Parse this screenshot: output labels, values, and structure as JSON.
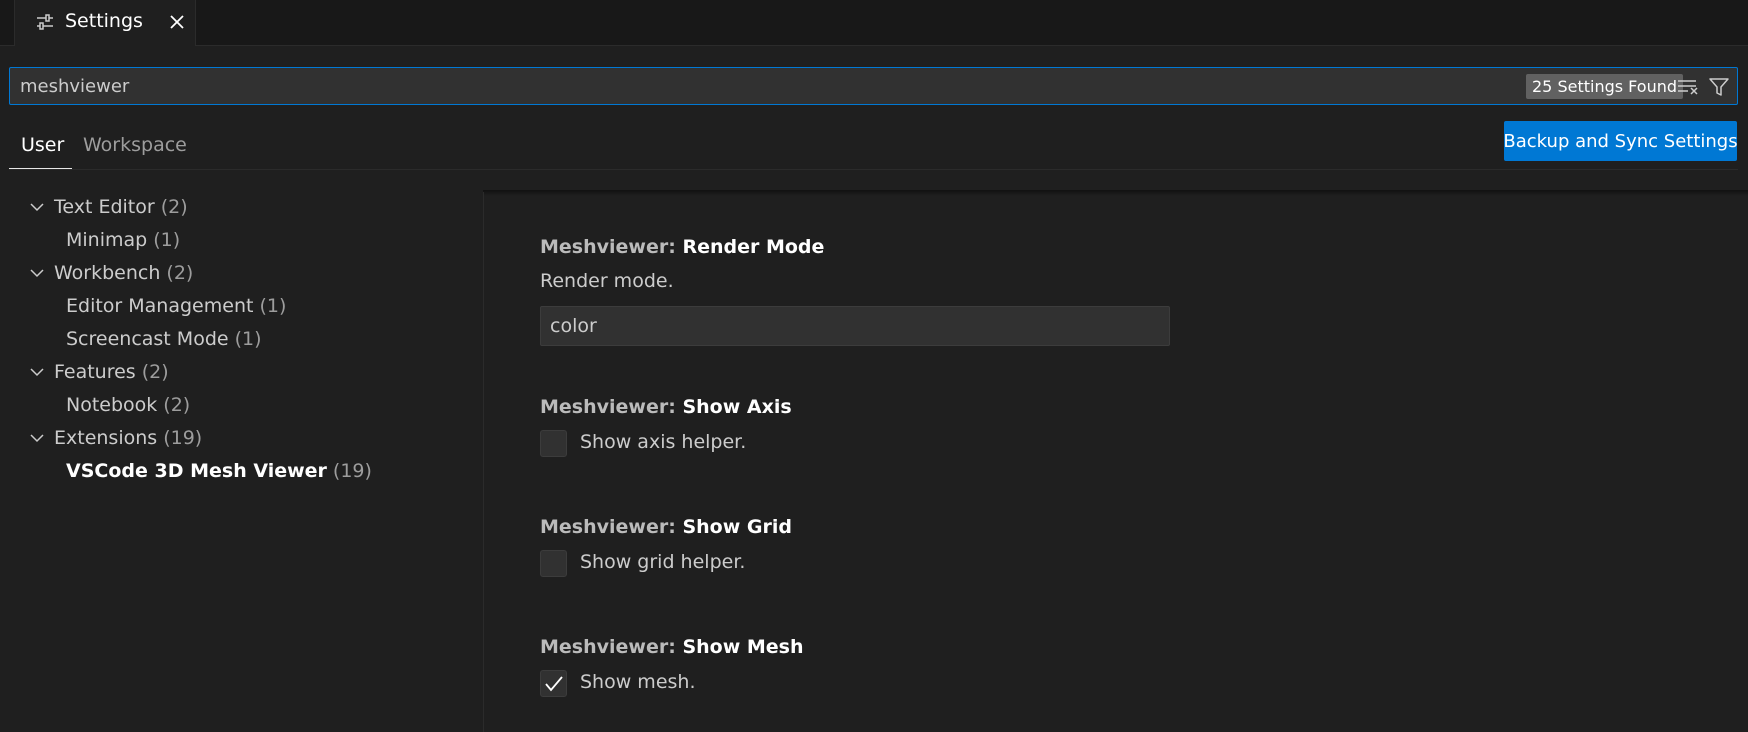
{
  "tab": {
    "title": "Settings"
  },
  "search": {
    "value": "meshviewer",
    "results_badge": "25 Settings Found"
  },
  "scope_tabs": [
    {
      "label": "User",
      "active": true
    },
    {
      "label": "Workspace",
      "active": false
    }
  ],
  "sync_button": {
    "label": "Backup and Sync Settings"
  },
  "toc": {
    "items": [
      {
        "label": "Text Editor",
        "count": "(2)",
        "level": 1
      },
      {
        "label": "Minimap",
        "count": "(1)",
        "level": 2
      },
      {
        "label": "Workbench",
        "count": "(2)",
        "level": 1
      },
      {
        "label": "Editor Management",
        "count": "(1)",
        "level": 2
      },
      {
        "label": "Screencast Mode",
        "count": "(1)",
        "level": 2
      },
      {
        "label": "Features",
        "count": "(2)",
        "level": 1
      },
      {
        "label": "Notebook",
        "count": "(2)",
        "level": 2
      },
      {
        "label": "Extensions",
        "count": "(19)",
        "level": 1
      },
      {
        "label": "VSCode 3D Mesh Viewer",
        "count": "(19)",
        "level": 2,
        "selected": true
      }
    ]
  },
  "settings": [
    {
      "category": "Meshviewer: ",
      "name": "Render Mode",
      "description": "Render mode.",
      "value": "color"
    },
    {
      "category": "Meshviewer: ",
      "name": "Show Axis",
      "label": "Show axis helper.",
      "checked": false
    },
    {
      "category": "Meshviewer: ",
      "name": "Show Grid",
      "label": "Show grid helper.",
      "checked": false
    },
    {
      "category": "Meshviewer: ",
      "name": "Show Mesh",
      "label": "Show mesh.",
      "checked": true
    }
  ],
  "colors": {
    "accent": "#0078d4",
    "background": "#1f1f1f"
  }
}
